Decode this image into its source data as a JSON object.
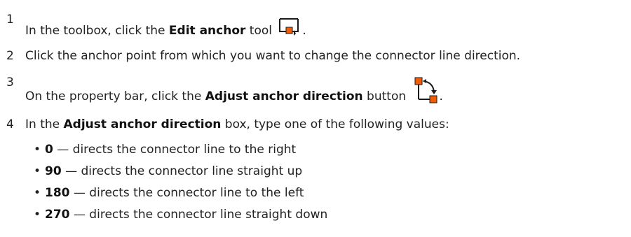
{
  "steps": [
    {
      "number": "1",
      "pre": "In the toolbox, click the ",
      "bold": "Edit anchor",
      "post": " tool",
      "icon": "edit-anchor-tool-icon",
      "end": "."
    },
    {
      "number": "2",
      "text": "Click the anchor point from which you want to change the connector line direction."
    },
    {
      "number": "3",
      "pre": "On the property bar, click the ",
      "bold": "Adjust anchor direction",
      "post": " button",
      "icon": "adjust-anchor-direction-icon",
      "end": "."
    },
    {
      "number": "4",
      "pre": "In the ",
      "bold": "Adjust anchor direction",
      "post": " box, type one of the following values:"
    }
  ],
  "bullets": [
    {
      "value": "0",
      "text": " — directs the connector line to the right"
    },
    {
      "value": "90",
      "text": " — directs the connector line straight up"
    },
    {
      "value": "180",
      "text": " — directs the connector line to the left"
    },
    {
      "value": "270",
      "text": " — directs the connector line straight down"
    }
  ],
  "colors": {
    "icon_accent": "#f25c05",
    "icon_stroke": "#1a1a1a"
  }
}
